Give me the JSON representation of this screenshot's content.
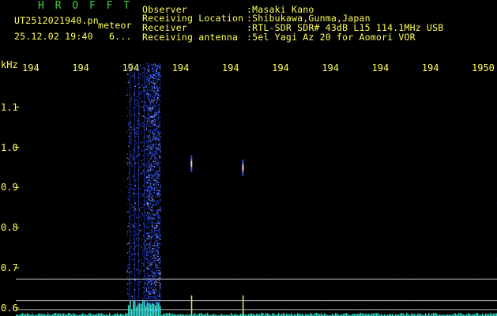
{
  "header": {
    "app_name": "H R O F F T",
    "file_name": "UT2512021940.pn",
    "event_type": "meteor",
    "datetime": "25.12.02 19:40",
    "count": "6..."
  },
  "info": {
    "observer_label": "Observer",
    "observer_value": ":Masaki Kano",
    "location_label": "Receiving Location",
    "location_value": ":Shibukawa,Gunma,Japan",
    "receiver_label": "Receiver",
    "receiver_value": ":RTL-SDR SDR# 43dB L15 114.1MHz USB",
    "antenna_label": "Receiving antenna",
    "antenna_value": ":5el Yagi Az 20 for Aomori VOR"
  },
  "colors": {
    "text_yellow": "#ffff55",
    "title_green": "#39d43a",
    "background": "#000000",
    "signal_blue": "#2f56ff",
    "baseline_cyan": "#33e0c8"
  },
  "chart_data": {
    "type": "heatmap",
    "ylabel": "kHz",
    "y_ticks": [
      "1.1",
      "1.0",
      "0.9",
      "0.8",
      "0.7",
      "0.6"
    ],
    "ylim": [
      0.58,
      1.18
    ],
    "x_ticks": [
      "194",
      "194",
      "194",
      "194",
      "194",
      "194",
      "194",
      "194",
      "194",
      "1950"
    ],
    "horizontal_lines_khz": [
      0.672,
      0.618,
      0.596
    ],
    "echoes": [
      {
        "x_frac": 0.365,
        "freq_khz": 0.96
      },
      {
        "x_frac": 0.472,
        "freq_khz": 0.95
      }
    ],
    "noise_band": {
      "x_start_frac": 0.23,
      "x_end_frac": 0.3
    }
  }
}
